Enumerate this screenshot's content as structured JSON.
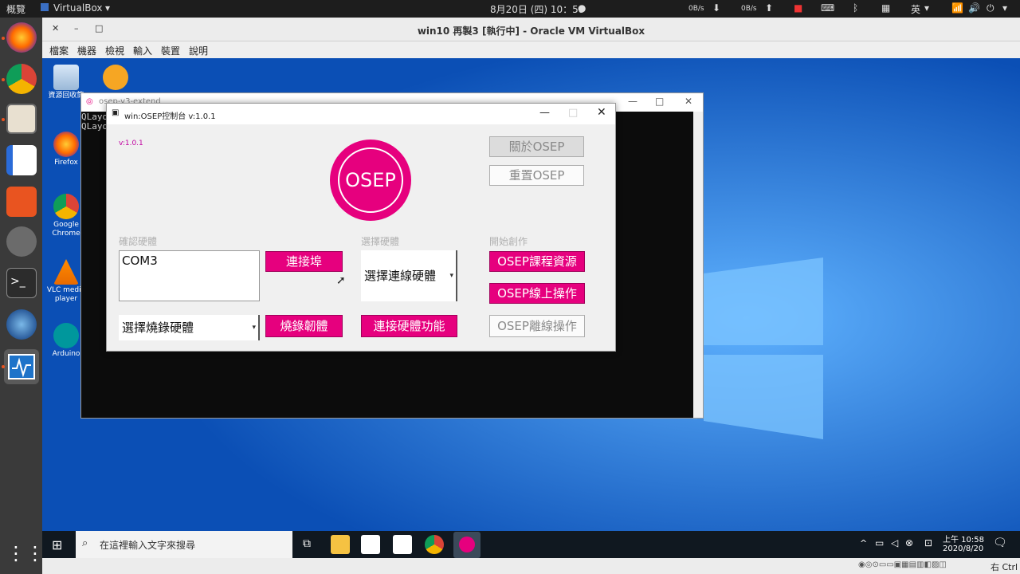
{
  "topbar": {
    "activities": "概覽",
    "app_menu": "VirtualBox",
    "clock": "8月20日 (四) 10：58",
    "net_down": "0B/s",
    "net_up": "0B/s",
    "input_method": "英"
  },
  "vbox": {
    "title": "win10 再製3 [執行中] - Oracle VM VirtualBox",
    "menu": [
      "檔案",
      "機器",
      "檢視",
      "輸入",
      "裝置",
      "說明"
    ],
    "status_right": "右 Ctrl"
  },
  "desktop": {
    "icons": [
      {
        "label": "資源回收筒"
      },
      {
        "label": ""
      },
      {
        "label": "Firefox"
      },
      {
        "label": "Google Chrome"
      },
      {
        "label": "VLC media player"
      },
      {
        "label": "Arduino"
      }
    ]
  },
  "console_window": {
    "title": "osep-v3-extend",
    "lines": [
      "QLayo",
      "QLayo"
    ]
  },
  "osep_app": {
    "title": "win:OSEP控制台 v:1.0.1",
    "version": "v:1.0.1",
    "logo_text": "OSEP",
    "about_btn": "關於OSEP",
    "reset_btn": "重置OSEP",
    "confirm_label": "確認硬體",
    "port_value": "COM3",
    "connect_port_btn": "連接埠",
    "choose_label": "選擇硬體",
    "choose_select": "選擇連線硬體",
    "start_label": "開始創作",
    "course_btn": "OSEP課程資源",
    "online_btn": "OSEP線上操作",
    "burn_select": "選擇燒錄硬體",
    "burn_btn": "燒錄韌體",
    "connect_hw_btn": "連接硬體功能",
    "offline_btn": "OSEP離線操作"
  },
  "taskbar": {
    "search_placeholder": "在這裡輸入文字來搜尋",
    "time": "上午 10:58",
    "date": "2020/8/20"
  },
  "colors": {
    "accent": "#e6007e",
    "desktop": "#0e5fd1"
  }
}
